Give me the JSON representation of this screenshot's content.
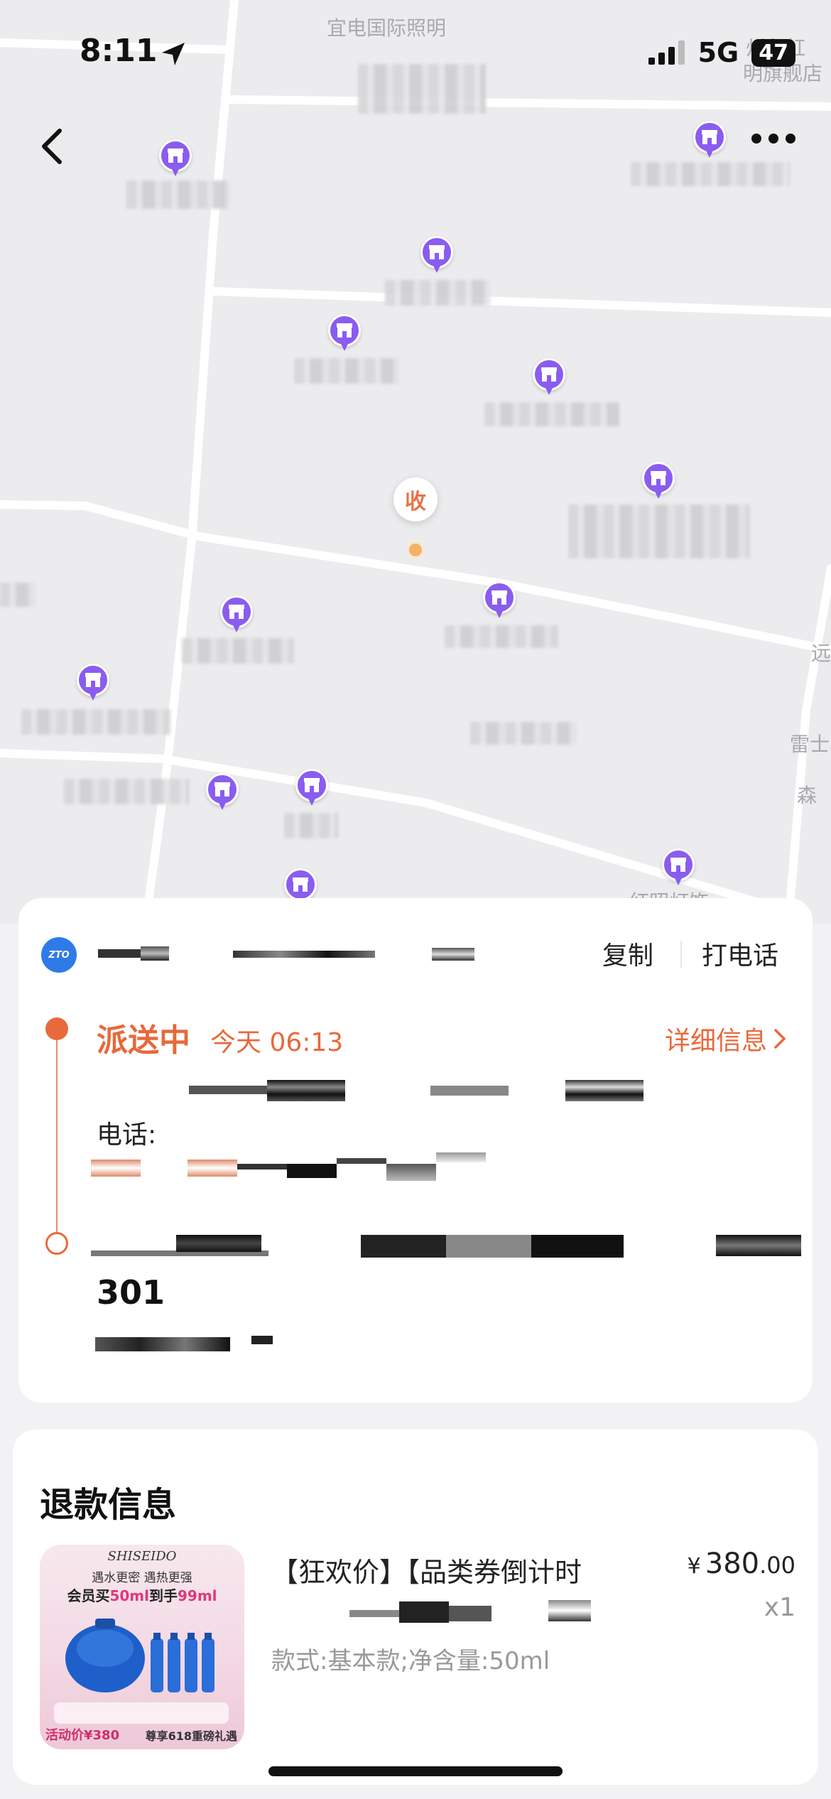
{
  "status_bar": {
    "time": "8:11",
    "network": "5G",
    "battery": "47"
  },
  "map": {
    "labels": [
      "宜电国际照明",
      "州留虹",
      "明旗舰店",
      "远",
      "雷士",
      "森",
      "红昭灯饰"
    ],
    "receiver_marker": "收"
  },
  "delivery": {
    "courier_logo": "ZTO",
    "copy_label": "复制",
    "call_label": "打电话",
    "status": "派送中",
    "status_time": "今天 06:13",
    "detail_link": "详细信息",
    "phone_label": "电话:",
    "room": "301"
  },
  "refund": {
    "title": "退款信息",
    "product": {
      "name": "【狂欢价】【品类券倒计时",
      "currency": "¥",
      "price_int": "380",
      "price_dec": ".00",
      "qty": "x1",
      "spec": "款式:基本款;净含量:50ml",
      "image": {
        "brand": "SHISEIDO",
        "slogan": "遇水更密 遇热更强",
        "promo_prefix": "会员买",
        "promo_a": "50ml",
        "promo_mid": "到手",
        "promo_b": "99ml",
        "price_tag": "活动价¥380",
        "footer_tag": "尊享618重磅礼遇"
      }
    }
  }
}
